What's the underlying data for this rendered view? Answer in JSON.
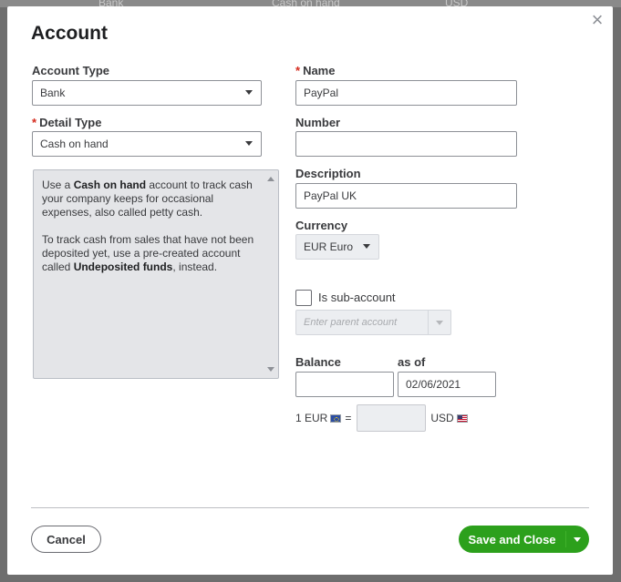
{
  "background": {
    "cells": [
      "Bank",
      "Cash on hand",
      "USD"
    ]
  },
  "dialog": {
    "title": "Account",
    "close_icon": "close-icon",
    "account_type": {
      "label": "Account Type",
      "value": "Bank"
    },
    "detail_type": {
      "label": "Detail Type",
      "value": "Cash on hand"
    },
    "description_help": {
      "p1_a": "Use a ",
      "p1_b": "Cash on hand",
      "p1_c": " account to track cash your company keeps for occasional expenses, also called petty cash.",
      "p2_a": "To track cash from sales that have not been deposited yet, use a pre-created account called ",
      "p2_b": "Undeposited funds",
      "p2_c": ", instead."
    },
    "name": {
      "label": "Name",
      "value": "PayPal"
    },
    "number": {
      "label": "Number",
      "value": ""
    },
    "description": {
      "label": "Description",
      "value": "PayPal UK"
    },
    "currency": {
      "label": "Currency",
      "value": "EUR Euro"
    },
    "sub_account": {
      "label": "Is sub-account",
      "checked": false,
      "parent_placeholder": "Enter parent account"
    },
    "balance": {
      "label": "Balance",
      "value": ""
    },
    "as_of": {
      "label": "as of",
      "value": "02/06/2021"
    },
    "exchange": {
      "left": "1 EUR",
      "equals": "=",
      "right": "USD",
      "rate": ""
    },
    "buttons": {
      "cancel": "Cancel",
      "save": "Save and Close"
    }
  },
  "colors": {
    "primary": "#2ca01c",
    "required": "#d52b1e",
    "text": "#393a3d"
  }
}
